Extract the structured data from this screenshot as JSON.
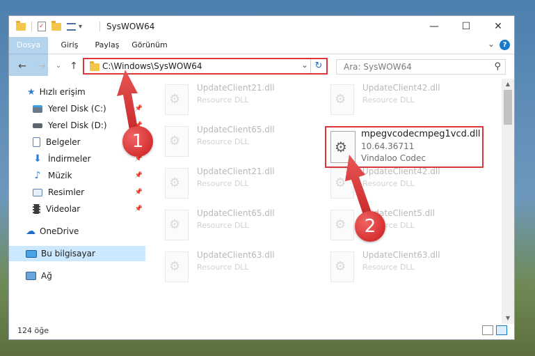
{
  "window": {
    "title": "SysWOW64",
    "buttons": {
      "minimize": "—",
      "maximize": "☐",
      "close": "✕"
    },
    "quick_access_dropdown": "▾"
  },
  "ribbon": {
    "tabs": [
      "Dosya",
      "Giriş",
      "Paylaş",
      "Görünüm"
    ],
    "expand": "⌄",
    "help": "?"
  },
  "navigation": {
    "back": "←",
    "forward": "→",
    "recent": "⌄",
    "up": "↑",
    "address": "C:\\Windows\\SysWOW64",
    "address_dropdown": "⌄",
    "refresh": "↻",
    "search_placeholder": "Ara: SysWOW64",
    "search_icon": "⚲"
  },
  "sidebar": {
    "items": [
      {
        "label": "Hızlı erişim",
        "icon": "star-icon",
        "pinned": false
      },
      {
        "label": "Yerel Disk (C:)",
        "icon": "drive-icon",
        "pinned": true
      },
      {
        "label": "Yerel Disk (D:)",
        "icon": "drive-icon",
        "pinned": true
      },
      {
        "label": "Belgeler",
        "icon": "documents-icon",
        "pinned": true
      },
      {
        "label": "İndirmeler",
        "icon": "download-icon",
        "pinned": true
      },
      {
        "label": "Müzik",
        "icon": "music-icon",
        "pinned": true
      },
      {
        "label": "Resimler",
        "icon": "pictures-icon",
        "pinned": true
      },
      {
        "label": "Videolar",
        "icon": "videos-icon",
        "pinned": true
      },
      {
        "label": "OneDrive",
        "icon": "cloud-icon",
        "pinned": false
      },
      {
        "label": "Bu bilgisayar",
        "icon": "computer-icon",
        "pinned": false,
        "selected": true
      },
      {
        "label": "Ağ",
        "icon": "network-icon",
        "pinned": false
      }
    ],
    "pin_glyph": "📌"
  },
  "files": [
    {
      "name": "UpdateClient21.dll",
      "desc": "Resource DLL"
    },
    {
      "name": "UpdateClient42.dll",
      "desc": "Resource DLL"
    },
    {
      "name": "UpdateClient65.dll",
      "desc": "Resource DLL"
    },
    {
      "name": "UpdateClient21.dll",
      "desc": "Resource DLL"
    },
    {
      "name": "UpdateClient42.dll",
      "desc": "Resource DLL"
    },
    {
      "name": "UpdateClient65.dll",
      "desc": "Resource DLL"
    },
    {
      "name": "UpdateClient5.dll",
      "desc": "Resource DLL"
    },
    {
      "name": "UpdateClient63.dll",
      "desc": "Resource DLL"
    },
    {
      "name": "UpdateClient63.dll",
      "desc": "Resource DLL"
    }
  ],
  "featured_file": {
    "name": "mpegvcodecmpeg1vcd.dll",
    "version": "10.64.36711",
    "description": "Vindaloo Codec"
  },
  "status": {
    "item_count": "124 öğe"
  },
  "callouts": [
    "1",
    "2"
  ],
  "colors": {
    "accent": "#1979ca",
    "highlight": "#d9363a",
    "selected_bg": "#cce8ff"
  }
}
